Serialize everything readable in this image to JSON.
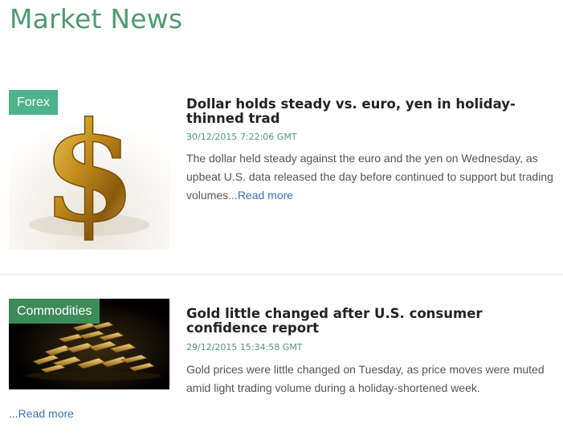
{
  "page": {
    "title": "Market News"
  },
  "articles": [
    {
      "category": "Forex",
      "headline": "Dollar holds steady vs. euro, yen in holiday-thinned trad",
      "date": "30/12/2015 7:22:06 GMT",
      "summary": "The dollar held steady against the euro and the yen on Wednesday, as upbeat U.S. data released the day before continued to support but trading volumes...",
      "read_more": "Read more",
      "image": "gold-dollar-sign"
    },
    {
      "category": "Commodities",
      "headline": "Gold little changed after U.S. consumer confidence report",
      "date": "29/12/2015 15:34:58 GMT",
      "summary": "Gold prices were little changed on Tuesday, as price moves were muted amid light trading volume during a holiday-shortened week.",
      "trailing_prefix": "...",
      "read_more": "Read more",
      "image": "gold-bars-pile"
    }
  ],
  "colors": {
    "title_green": "#4f9a70",
    "forex_badge": "#4db38a",
    "commodities_badge": "#3d8b58",
    "link_blue": "#3973b5"
  }
}
